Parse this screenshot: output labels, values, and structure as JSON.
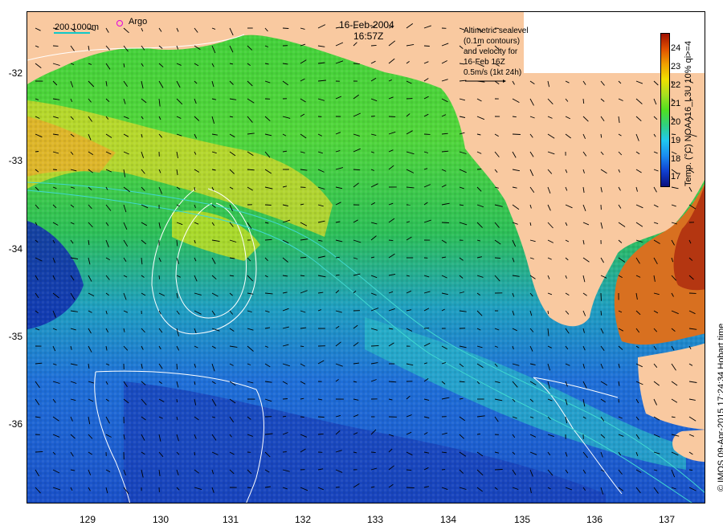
{
  "map": {
    "date": "16-Feb-2004",
    "time": "16:57Z",
    "scale_label": "200  1000m",
    "argo_label": "Argo",
    "legend_note": [
      "Altimetric sealevel",
      "(0.1m contours)",
      "and velocity for",
      "16-Feb 16Z",
      "0.5m/s (1kt 24h)"
    ],
    "credit": "© IMOS 09-Apr-2015 17:24:34 Hobart time",
    "lat_ticks": [
      "-32",
      "-33",
      "-34",
      "-35",
      "-36"
    ],
    "lon_ticks": [
      "129",
      "130",
      "131",
      "132",
      "133",
      "134",
      "135",
      "136",
      "137"
    ],
    "lat_range": [
      -36.95,
      -31.3
    ],
    "lon_range": [
      128.2,
      137.45
    ]
  },
  "colorbar": {
    "title": "Temp. (°C) NOAA16_L3U 10% qi>=4",
    "ticks": [
      "24",
      "23",
      "22",
      "21",
      "20",
      "19",
      "18",
      "17"
    ],
    "min": 16.5,
    "max": 24.8
  },
  "colors": {
    "land": "#f9c9a0",
    "ocean_mid": "#3cc83c",
    "ocean_cold": "#1e5fd4",
    "ocean_warm": "#e0c020",
    "gulf_hot": "#c04010",
    "contour": "#ffffff",
    "isobath": "#40d8d0"
  }
}
